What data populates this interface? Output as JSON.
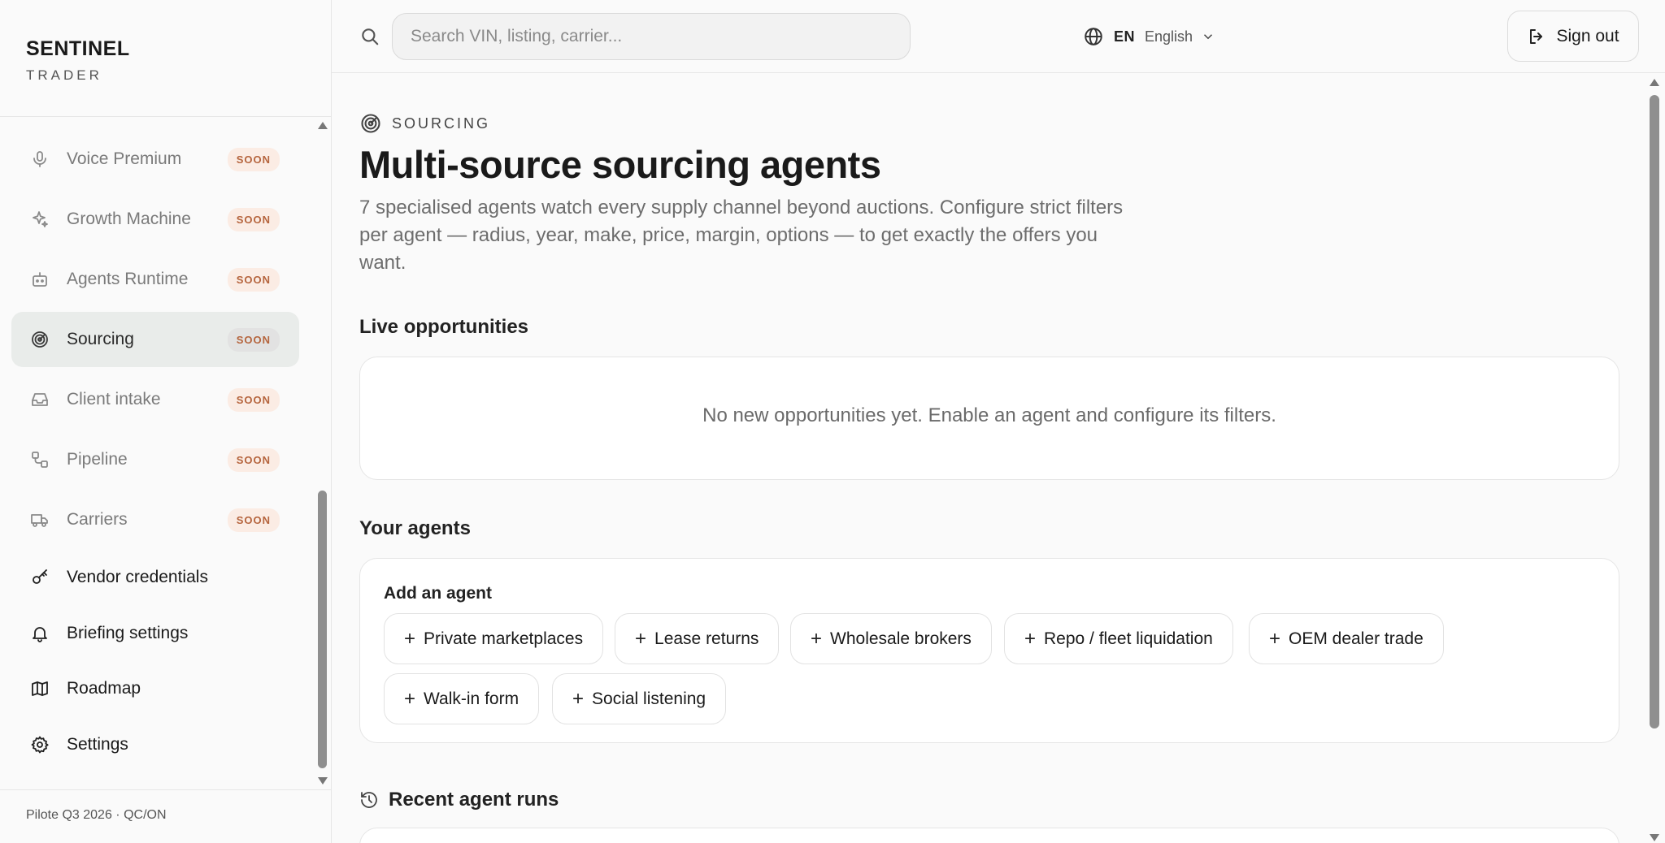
{
  "brand": {
    "name": "SENTINEL",
    "sub": "TRADER"
  },
  "sidebar": {
    "items": [
      {
        "label": "Voice Premium",
        "badge": "SOON",
        "icon": "microphone-icon"
      },
      {
        "label": "Growth Machine",
        "badge": "SOON",
        "icon": "sparkles-icon"
      },
      {
        "label": "Agents Runtime",
        "badge": "SOON",
        "icon": "bot-icon"
      },
      {
        "label": "Sourcing",
        "badge": "SOON",
        "icon": "radar-icon",
        "active": true
      },
      {
        "label": "Client intake",
        "badge": "SOON",
        "icon": "inbox-icon"
      },
      {
        "label": "Pipeline",
        "badge": "SOON",
        "icon": "workflow-icon"
      },
      {
        "label": "Carriers",
        "badge": "SOON",
        "icon": "truck-icon"
      },
      {
        "label": "Vendor credentials",
        "icon": "key-icon"
      },
      {
        "label": "Briefing settings",
        "icon": "bell-icon"
      },
      {
        "label": "Roadmap",
        "icon": "map-icon"
      },
      {
        "label": "Settings",
        "icon": "gear-icon"
      }
    ],
    "footer": "Pilote Q3 2026 · QC/ON"
  },
  "topbar": {
    "search_placeholder": "Search VIN, listing, carrier...",
    "lang_code": "EN",
    "lang_name": "English",
    "signout_label": "Sign out"
  },
  "page": {
    "eyebrow": "SOURCING",
    "title": "Multi-source sourcing agents",
    "description": "7 specialised agents watch every supply channel beyond auctions. Configure strict filters per agent — radius, year, make, price, margin, options — to get exactly the offers you want."
  },
  "live": {
    "title": "Live opportunities",
    "empty": "No new opportunities yet. Enable an agent and configure its filters."
  },
  "agents": {
    "title": "Your agents",
    "add_title": "Add an agent",
    "chips": [
      "Private marketplaces",
      "Lease returns",
      "Wholesale brokers",
      "Repo / fleet liquidation",
      "OEM dealer trade",
      "Walk-in form",
      "Social listening"
    ]
  },
  "recent": {
    "title": "Recent agent runs"
  },
  "colors": {
    "accent_badge": "#b5643d",
    "badge_bg": "#fbece4",
    "active_bg": "#e9ecea"
  }
}
